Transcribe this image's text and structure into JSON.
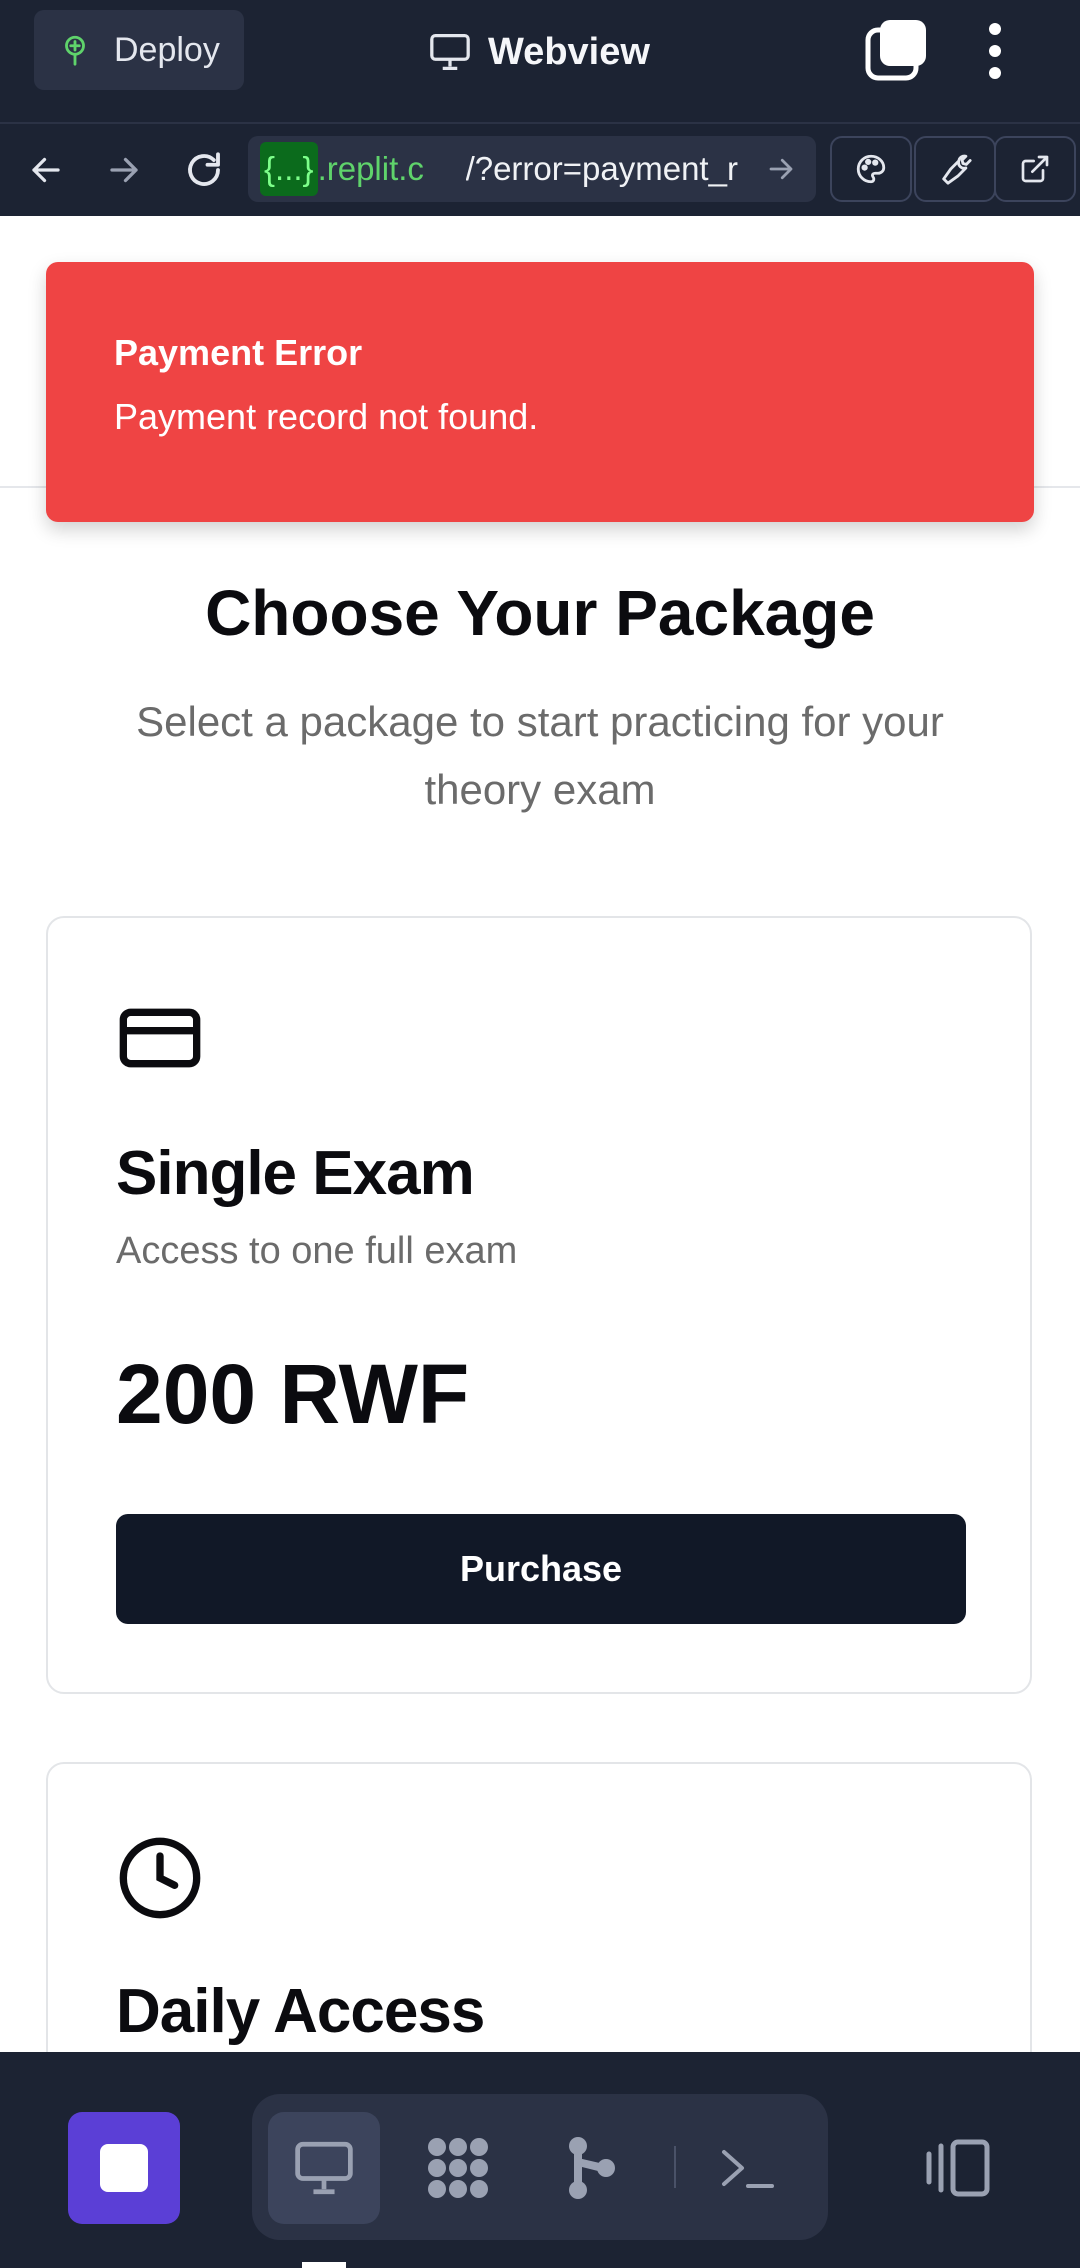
{
  "header": {
    "deploy_label": "Deploy",
    "webview_title": "Webview",
    "icons": [
      "deploy-icon",
      "monitor-icon",
      "tabs-icon",
      "more-vertical-icon"
    ]
  },
  "navbar": {
    "url_tag": "{...}",
    "url_host": ".replit.c",
    "url_path": "/?error=payment_r",
    "icons": [
      "back-arrow-icon",
      "forward-arrow-icon",
      "reload-icon",
      "arrow-right-icon",
      "palette-icon",
      "wrench-icon",
      "external-link-icon"
    ]
  },
  "alert": {
    "title": "Payment Error",
    "message": "Payment record not found.",
    "color": "#ef4444"
  },
  "main": {
    "heading": "Choose Your Package",
    "subheading": "Select a package to start practicing for your theory exam",
    "packages": [
      {
        "icon": "credit-card-icon",
        "title": "Single Exam",
        "description": "Access to one full exam",
        "price": "200 RWF",
        "button": "Purchase"
      },
      {
        "icon": "clock-icon",
        "title": "Daily Access"
      }
    ]
  },
  "bottombar": {
    "accent": "#5b3fd6",
    "icons": [
      "stop-icon",
      "monitor-icon",
      "apps-icon",
      "git-branch-icon",
      "terminal-icon",
      "devices-icon"
    ]
  }
}
